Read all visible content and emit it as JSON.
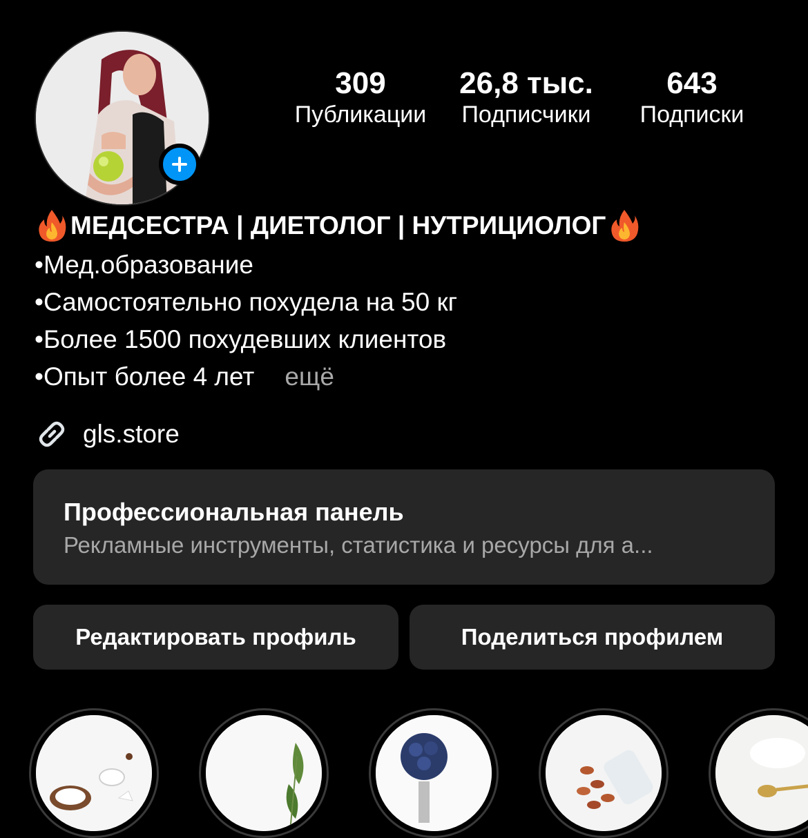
{
  "profile": {
    "avatar_alt": "profile photo",
    "add_story_icon": "plus-icon"
  },
  "stats": [
    {
      "value": "309",
      "label": "Публикации"
    },
    {
      "value": "26,8 тыс.",
      "label": "Подписчики"
    },
    {
      "value": "643",
      "label": "Подписки"
    }
  ],
  "bio": {
    "title": "МЕДСЕСТРА | ДИЕТОЛОГ | НУТРИЦИОЛОГ",
    "lines": [
      "•Мед.образование",
      "•Самостоятельно похудела на 50 кг",
      "•Более 1500 похудевших клиентов",
      "•Опыт более 4 лет"
    ],
    "more": "ещё",
    "link": "gls.store"
  },
  "pro_panel": {
    "title": "Профессиональная панель",
    "subtitle": "Рекламные инструменты, статистика и ресурсы для а..."
  },
  "buttons": {
    "edit": "Редактировать профиль",
    "share": "Поделиться профилем"
  },
  "highlights": [
    "coconut",
    "leaves",
    "blueberries",
    "almonds",
    "spoon"
  ],
  "colors": {
    "background": "#000000",
    "panel": "#262626",
    "accent_blue": "#0095f6",
    "muted_text": "#a8a8a8"
  }
}
